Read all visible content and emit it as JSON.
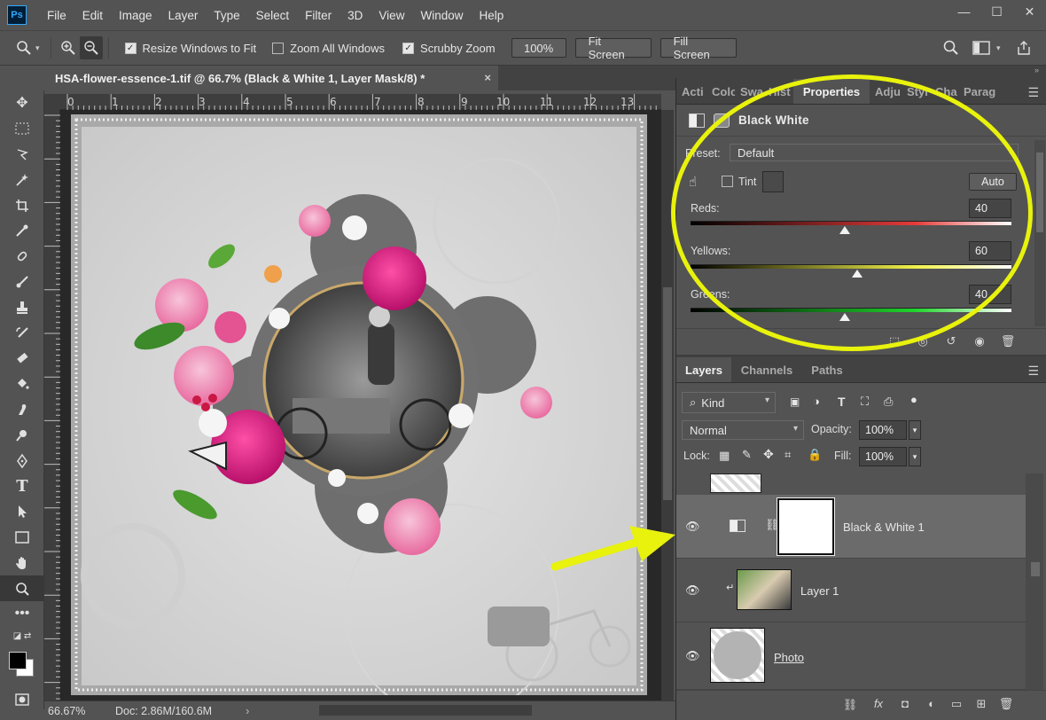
{
  "app": {
    "logo": "Ps",
    "menus": [
      "File",
      "Edit",
      "Image",
      "Layer",
      "Type",
      "Select",
      "Filter",
      "3D",
      "View",
      "Window",
      "Help"
    ],
    "window_controls": [
      "—",
      "☐",
      "✕"
    ]
  },
  "options_bar": {
    "resize_windows": {
      "label": "Resize Windows to Fit",
      "checked": true
    },
    "zoom_all": {
      "label": "Zoom All Windows",
      "checked": false
    },
    "scrubby_zoom": {
      "label": "Scrubby Zoom",
      "checked": true
    },
    "zoom_value": "100%",
    "fit_screen": "Fit Screen",
    "fill_screen": "Fill Screen"
  },
  "document": {
    "tab_title": "HSA-flower-essence-1.tif @ 66.7% (Black & White 1, Layer Mask/8) *",
    "close": "×",
    "ruler_labels": [
      "0",
      "1",
      "2",
      "3",
      "4",
      "5",
      "6",
      "7",
      "8",
      "9",
      "10",
      "11",
      "12",
      "13"
    ],
    "zoom": "66.67%",
    "doc_size": "Doc: 2.86M/160.6M",
    "status_chevron": "›"
  },
  "properties_panel": {
    "tabs": [
      "Acti",
      "Colo",
      "Swa",
      "Hist",
      "Properties",
      "Adju",
      "Styl",
      "Cha",
      "Parag"
    ],
    "active_tab": "Properties",
    "title": "Black  White",
    "preset_label": "Preset:",
    "preset_value": "Default",
    "tint_label": "Tint",
    "auto_label": "Auto",
    "sliders": [
      {
        "label": "Reds:",
        "value": "40",
        "fraction": 0.48,
        "color": "#e53a3a"
      },
      {
        "label": "Yellows:",
        "value": "60",
        "fraction": 0.52,
        "color": "#f0f04a"
      },
      {
        "label": "Greens:",
        "value": "40",
        "fraction": 0.48,
        "color": "#1fd42b"
      }
    ]
  },
  "layers_panel": {
    "tabs": [
      "Layers",
      "Channels",
      "Paths"
    ],
    "active_tab": "Layers",
    "kind_label": "Kind",
    "blend_mode": "Normal",
    "opacity_label": "Opacity:",
    "opacity_value": "100%",
    "lock_label": "Lock:",
    "fill_label": "Fill:",
    "fill_value": "100%",
    "layers": [
      {
        "name": "Black & White 1"
      },
      {
        "name": "Layer 1"
      },
      {
        "name": "Photo"
      }
    ]
  },
  "colors": {
    "highlight": "#e8f20c",
    "selected_layer": "#6b6b6b"
  }
}
